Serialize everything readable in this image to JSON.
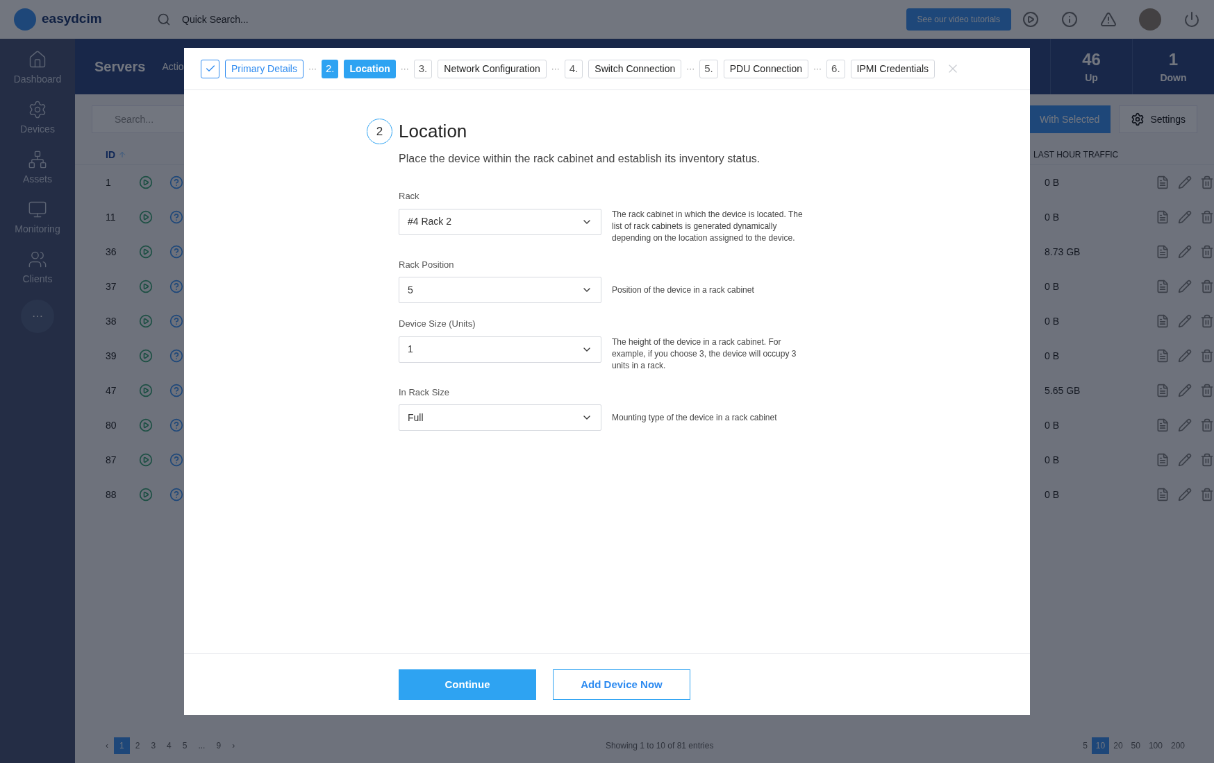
{
  "app": {
    "logo": "easydcim",
    "quick_search": {
      "placeholder": "Quick Search..."
    },
    "tutorials_button": "See our video tutorials"
  },
  "sidebar": {
    "items": [
      {
        "label": "Dashboard",
        "kind": "home"
      },
      {
        "label": "Devices",
        "kind": "gear"
      },
      {
        "label": "Assets",
        "kind": "tree"
      },
      {
        "label": "Monitoring",
        "kind": "monitor"
      },
      {
        "label": "Clients",
        "kind": "users"
      }
    ],
    "more": "···"
  },
  "page": {
    "title": "Servers",
    "tab": "Actio",
    "stats": [
      {
        "value": "46",
        "label": "Up"
      },
      {
        "value": "1",
        "label": "Down"
      }
    ],
    "search": {
      "placeholder": "Search..."
    },
    "with_selected": "With Selected",
    "settings": "Settings",
    "table": {
      "columns": [
        "ID",
        "LAST HOUR TRAFFIC"
      ],
      "rows": [
        {
          "id": "1",
          "traffic": "0 B"
        },
        {
          "id": "11",
          "traffic": "0 B"
        },
        {
          "id": "36",
          "traffic": "8.73 GB"
        },
        {
          "id": "37",
          "traffic": "0 B"
        },
        {
          "id": "38",
          "traffic": "0 B"
        },
        {
          "id": "39",
          "traffic": "0 B"
        },
        {
          "id": "47",
          "traffic": "5.65 GB"
        },
        {
          "id": "80",
          "traffic": "0 B"
        },
        {
          "id": "87",
          "traffic": "0 B"
        },
        {
          "id": "88",
          "traffic": "0 B"
        }
      ]
    },
    "pagination": {
      "prev": "‹",
      "pages": [
        {
          "label": "1",
          "selected": true
        },
        {
          "label": "2",
          "selected": false
        },
        {
          "label": "3",
          "selected": false
        },
        {
          "label": "4",
          "selected": false
        },
        {
          "label": "5",
          "selected": false
        },
        {
          "label": "...",
          "selected": false
        },
        {
          "label": "9",
          "selected": false
        }
      ],
      "next": "›"
    },
    "entries": "Showing 1 to 10 of 81 entries",
    "page_sizes": [
      {
        "label": "5",
        "selected": false
      },
      {
        "label": "10",
        "selected": true
      },
      {
        "label": "20",
        "selected": false
      },
      {
        "label": "50",
        "selected": false
      },
      {
        "label": "100",
        "selected": false
      },
      {
        "label": "200",
        "selected": false
      }
    ]
  },
  "modal": {
    "steps": [
      {
        "label": "Primary Details",
        "kind": "done"
      },
      {
        "number": "2.",
        "label": "Location",
        "kind": "current"
      },
      {
        "number": "3.",
        "label": "Network Configuration",
        "kind": "pending"
      },
      {
        "number": "4.",
        "label": "Switch Connection",
        "kind": "pending"
      },
      {
        "number": "5.",
        "label": "PDU Connection",
        "kind": "pending"
      },
      {
        "number": "6.",
        "label": "IPMI Credentials",
        "kind": "pending"
      }
    ],
    "separator": "···",
    "section_number": "2",
    "title": "Location",
    "description": "Place the device within the rack cabinet and establish its inventory status.",
    "fields": [
      {
        "label": "Rack",
        "value": "#4 Rack 2",
        "help": "The rack cabinet in which the device is located. The list of rack cabinets is generated dynamically depending on the location assigned to the device."
      },
      {
        "label": "Rack Position",
        "value": "5",
        "help": "Position of the device in a rack cabinet"
      },
      {
        "label": "Device Size (Units)",
        "value": "1",
        "help": "The height of the device in a rack cabinet. For example, if you choose 3, the device will occupy 3 units in a rack."
      },
      {
        "label": "In Rack Size",
        "value": "Full",
        "help": "Mounting type of the device in a rack cabinet"
      }
    ],
    "buttons": [
      {
        "label": "Continue",
        "kind": "primary"
      },
      {
        "label": "Add Device Now",
        "kind": "secondary"
      }
    ]
  }
}
